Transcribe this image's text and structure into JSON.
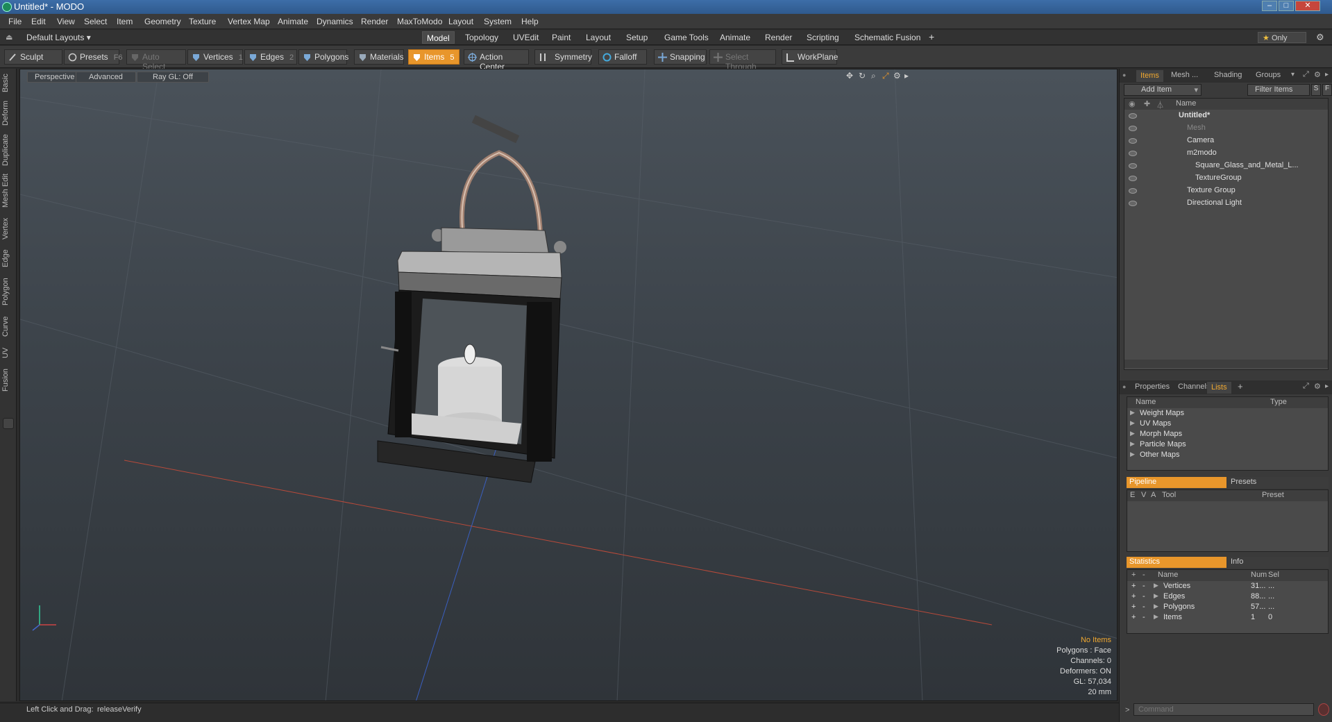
{
  "window": {
    "title": "Untitled* - MODO"
  },
  "menubar": [
    "File",
    "Edit",
    "View",
    "Select",
    "Item",
    "Geometry",
    "Texture",
    "Vertex Map",
    "Animate",
    "Dynamics",
    "Render",
    "MaxToModo",
    "Layout",
    "System",
    "Help"
  ],
  "layout_bar": {
    "layouts_dropdown": "Default Layouts",
    "tabs": [
      "Model",
      "Topology",
      "UVEdit",
      "Paint",
      "Layout",
      "Setup",
      "Game Tools",
      "Animate",
      "Render",
      "Scripting",
      "Schematic Fusion"
    ],
    "active_tab": "Model",
    "add": "+",
    "only_label": "Only"
  },
  "toolbar": {
    "sculpt": "Sculpt",
    "presets": "Presets",
    "presets_key": "F6",
    "auto_select": "Auto Select",
    "vertices": "Vertices",
    "vertices_key": "1",
    "edges": "Edges",
    "edges_key": "2",
    "polygons": "Polygons",
    "materials": "Materials",
    "items": "Items",
    "items_key": "5",
    "action_center": "Action Center",
    "symmetry": "Symmetry",
    "falloff": "Falloff",
    "snapping": "Snapping",
    "select_through": "Select Through",
    "workplane": "WorkPlane"
  },
  "left_tabs": [
    "Basic",
    "Deform",
    "Duplicate",
    "Mesh Edit",
    "Vertex",
    "Edge",
    "Polygon",
    "Curve",
    "UV",
    "Fusion"
  ],
  "viewport": {
    "view_mode": "Perspective",
    "shading": "Advanced",
    "raygl": "Ray GL: Off",
    "info": {
      "selection": "No Items",
      "polygons": "Polygons : Face",
      "channels": "Channels: 0",
      "deformers": "Deformers: ON",
      "gl": "GL: 57,034",
      "scale": "20 mm"
    }
  },
  "status": {
    "hint": "Left Click and Drag:",
    "action": "releaseVerify"
  },
  "items_panel": {
    "tabs": [
      "Items",
      "Mesh ...",
      "Shading",
      "Groups"
    ],
    "active_tab": "Items",
    "add_item": "Add Item",
    "filter": "Filter Items",
    "s_btn": "S",
    "f_btn": "F",
    "name_header": "Name",
    "tree": [
      {
        "label": "Untitled*",
        "depth": 0,
        "bold": true
      },
      {
        "label": "Mesh",
        "depth": 1,
        "dim": true
      },
      {
        "label": "Camera",
        "depth": 1
      },
      {
        "label": "m2modo",
        "depth": 1
      },
      {
        "label": "Square_Glass_and_Metal_L...",
        "depth": 2
      },
      {
        "label": "TextureGroup",
        "depth": 2
      },
      {
        "label": "Texture Group",
        "depth": 1
      },
      {
        "label": "Directional Light",
        "depth": 1
      }
    ]
  },
  "lists_panel": {
    "tabs": [
      "Properties",
      "Channels",
      "Lists"
    ],
    "active_tab": "Lists",
    "add": "+",
    "col_name": "Name",
    "col_type": "Type",
    "rows": [
      "Weight Maps",
      "UV Maps",
      "Morph Maps",
      "Particle Maps",
      "Other Maps"
    ]
  },
  "pipeline_panel": {
    "tabs": [
      "Pipeline",
      "Presets"
    ],
    "cols": [
      "E",
      "V",
      "A",
      "Tool",
      "Preset"
    ]
  },
  "stats_panel": {
    "tabs": [
      "Statistics",
      "Info"
    ],
    "cols": {
      "plus": "+",
      "minus": "-",
      "name": "Name",
      "num": "Num",
      "sel": "Sel"
    },
    "rows": [
      {
        "name": "Vertices",
        "num": "31...",
        "sel": "..."
      },
      {
        "name": "Edges",
        "num": "88...",
        "sel": "..."
      },
      {
        "name": "Polygons",
        "num": "57...",
        "sel": "..."
      },
      {
        "name": "Items",
        "num": "1",
        "sel": "0"
      }
    ]
  },
  "command": {
    "placeholder": "Command"
  },
  "colors": {
    "accent": "#e8962b",
    "selection_text": "#f0a830"
  }
}
